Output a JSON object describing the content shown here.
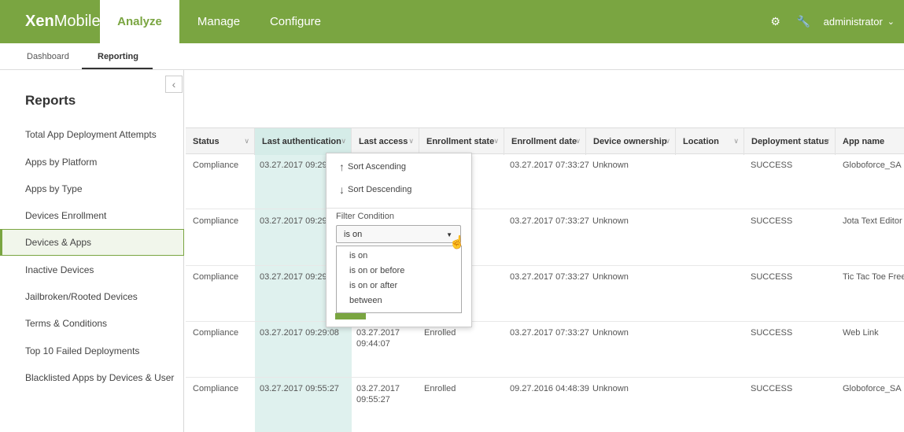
{
  "brand": {
    "bold": "Xen",
    "light": "Mobile"
  },
  "nav": {
    "analyze": "Analyze",
    "manage": "Manage",
    "configure": "Configure"
  },
  "user": {
    "name": "administrator"
  },
  "subnav": {
    "dashboard": "Dashboard",
    "reporting": "Reporting"
  },
  "sidebar": {
    "title": "Reports",
    "items": [
      "Total App Deployment Attempts",
      "Apps by Platform",
      "Apps by Type",
      "Devices Enrollment",
      "Devices & Apps",
      "Inactive Devices",
      "Jailbroken/Rooted Devices",
      "Terms & Conditions",
      "Top 10 Failed Deployments",
      "Blacklisted Apps by Devices & User"
    ],
    "active_index": 4
  },
  "table": {
    "columns": [
      "Status",
      "Last authentication",
      "Last access",
      "Enrollment state",
      "Enrollment date",
      "Device ownership",
      "Location",
      "Deployment status",
      "App name"
    ],
    "rows": [
      {
        "status": "Compliance",
        "last_auth": "03.27.2017 09:29:0",
        "last_access_1": "",
        "last_access_2": "",
        "enrollment_state": "",
        "enrollment_date": "03.27.2017 07:33:27",
        "ownership": "Unknown",
        "location": "",
        "deployment": "SUCCESS",
        "app": "Globoforce_SA"
      },
      {
        "status": "Compliance",
        "last_auth": "03.27.2017 09:29:0",
        "last_access_1": "",
        "last_access_2": "",
        "enrollment_state": "",
        "enrollment_date": "03.27.2017 07:33:27",
        "ownership": "Unknown",
        "location": "",
        "deployment": "SUCCESS",
        "app": "Jota Text Editor"
      },
      {
        "status": "Compliance",
        "last_auth": "03.27.2017 09:29:0",
        "last_access_1": "",
        "last_access_2": "",
        "enrollment_state": "",
        "enrollment_date": "03.27.2017 07:33:27",
        "ownership": "Unknown",
        "location": "",
        "deployment": "SUCCESS",
        "app": "Tic Tac Toe Free"
      },
      {
        "status": "Compliance",
        "last_auth": "03.27.2017 09:29:08",
        "last_access_1": "03.27.2017",
        "last_access_2": "09:44:07",
        "enrollment_state": "Enrolled",
        "enrollment_date": "03.27.2017 07:33:27",
        "ownership": "Unknown",
        "location": "",
        "deployment": "SUCCESS",
        "app": "Web Link"
      },
      {
        "status": "Compliance",
        "last_auth": "03.27.2017 09:55:27",
        "last_access_1": "03.27.2017",
        "last_access_2": "09:55:27",
        "enrollment_state": "Enrolled",
        "enrollment_date": "09.27.2016 04:48:39",
        "ownership": "Unknown",
        "location": "",
        "deployment": "SUCCESS",
        "app": "Globoforce_SA"
      }
    ]
  },
  "menu": {
    "sort_asc": "Sort Ascending",
    "sort_desc": "Sort Descending",
    "filter_label": "Filter Condition",
    "filter_value": "is on",
    "options": [
      "is on",
      "is on or before",
      "is on or after",
      "between"
    ]
  },
  "colors": {
    "accent": "#7aa541",
    "highlight": "#dff1ee"
  },
  "icons": {
    "settings": "gear-icon",
    "tools": "wrench-icon",
    "collapse": "chevron-left-icon",
    "cursor": "hand-pointer-icon"
  }
}
